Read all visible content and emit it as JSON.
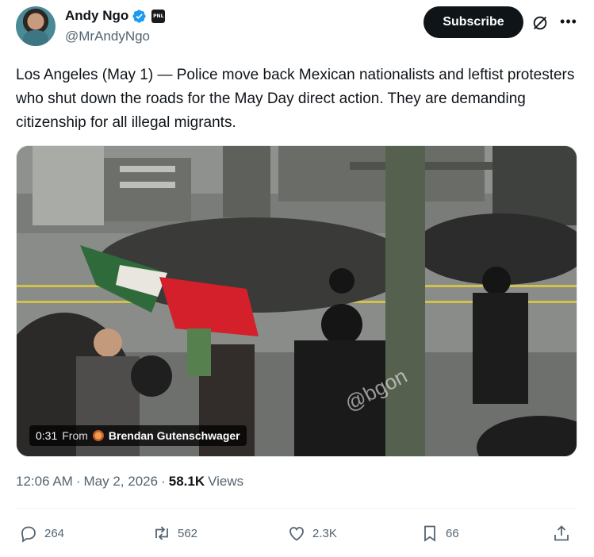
{
  "author": {
    "display_name": "Andy Ngo",
    "handle": "@MrAndyNgo",
    "affiliation_badge": "PNL"
  },
  "header": {
    "subscribe_label": "Subscribe"
  },
  "tweet": {
    "text": "Los Angeles (May 1) — Police move back Mexican nationalists and leftist protesters who shut down the roads for the May Day direct action. They are demanding citizenship for all illegal migrants."
  },
  "media": {
    "duration": "0:31",
    "from_label": "From",
    "source_name": "Brendan Gutenschwager",
    "watermark": "@bgon"
  },
  "meta": {
    "time": "12:06 AM",
    "separator": "·",
    "date": "May 2, 2026",
    "views_count": "58.1K",
    "views_label": "Views"
  },
  "actions": {
    "replies": "264",
    "reposts": "562",
    "likes": "2.3K",
    "bookmarks": "66"
  },
  "colors": {
    "verified": "#1d9bf0",
    "text_primary": "#0f1419",
    "text_secondary": "#536471"
  }
}
